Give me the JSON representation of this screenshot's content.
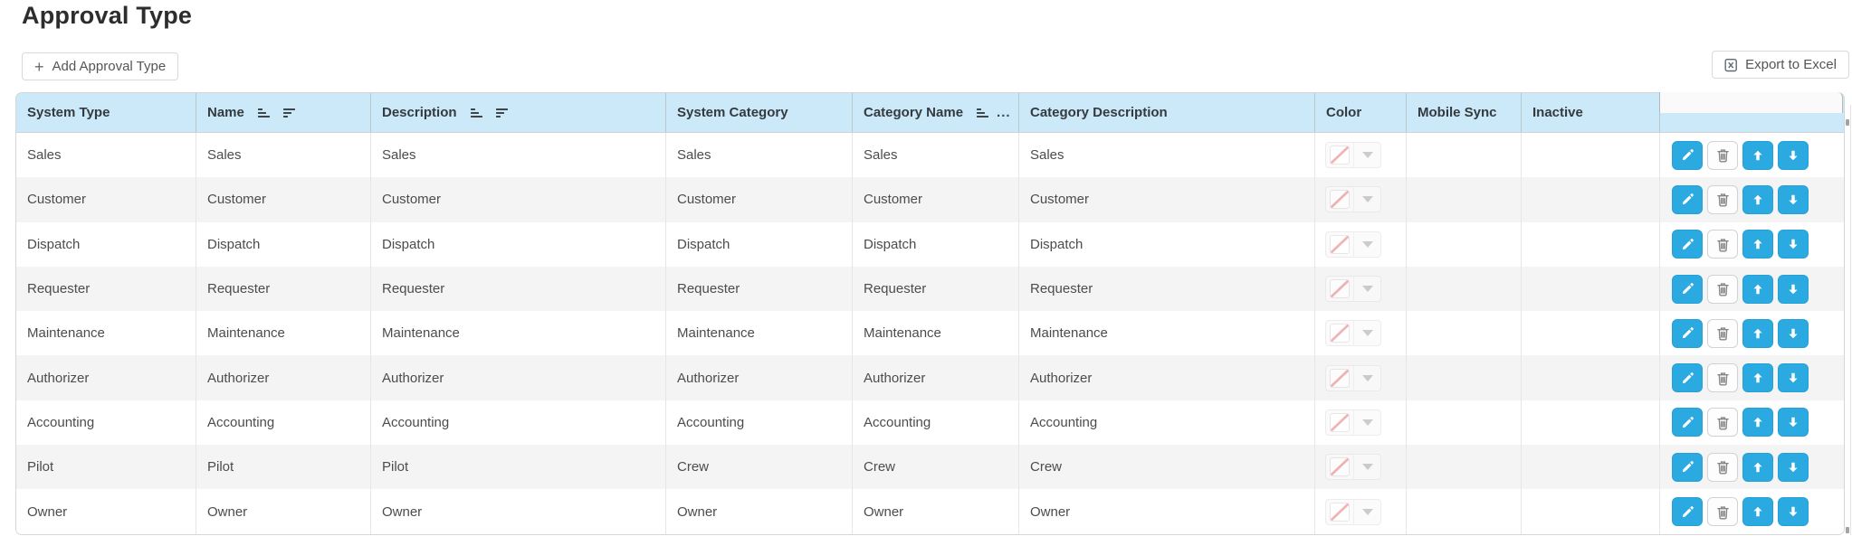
{
  "page": {
    "title": "Approval Type"
  },
  "toolbar": {
    "add_label": "Add Approval Type",
    "plus_glyph": "+",
    "export_label": "Export to Excel"
  },
  "grid": {
    "ellipsis_glyph": "...",
    "columns": [
      {
        "label": "System Type",
        "icons": []
      },
      {
        "label": "Name",
        "icons": [
          "asc",
          "desc"
        ]
      },
      {
        "label": "Description",
        "icons": [
          "asc",
          "desc"
        ]
      },
      {
        "label": "System Category",
        "icons": []
      },
      {
        "label": "Category Name",
        "icons": [
          "asc",
          "ellipsis"
        ]
      },
      {
        "label": "Category Description",
        "icons": []
      },
      {
        "label": "Color",
        "icons": []
      },
      {
        "label": "Mobile Sync",
        "icons": []
      },
      {
        "label": "Inactive",
        "icons": []
      },
      {
        "label": "",
        "icons": []
      }
    ],
    "rows": [
      {
        "system_type": "Sales",
        "name": "Sales",
        "description": "Sales",
        "system_category": "Sales",
        "category_name": "Sales",
        "category_description": "Sales",
        "color": "none",
        "mobile_sync": "",
        "inactive": ""
      },
      {
        "system_type": "Customer",
        "name": "Customer",
        "description": "Customer",
        "system_category": "Customer",
        "category_name": "Customer",
        "category_description": "Customer",
        "color": "none",
        "mobile_sync": "",
        "inactive": ""
      },
      {
        "system_type": "Dispatch",
        "name": "Dispatch",
        "description": "Dispatch",
        "system_category": "Dispatch",
        "category_name": "Dispatch",
        "category_description": "Dispatch",
        "color": "none",
        "mobile_sync": "",
        "inactive": ""
      },
      {
        "system_type": "Requester",
        "name": "Requester",
        "description": "Requester",
        "system_category": "Requester",
        "category_name": "Requester",
        "category_description": "Requester",
        "color": "none",
        "mobile_sync": "",
        "inactive": ""
      },
      {
        "system_type": "Maintenance",
        "name": "Maintenance",
        "description": "Maintenance",
        "system_category": "Maintenance",
        "category_name": "Maintenance",
        "category_description": "Maintenance",
        "color": "none",
        "mobile_sync": "",
        "inactive": ""
      },
      {
        "system_type": "Authorizer",
        "name": "Authorizer",
        "description": "Authorizer",
        "system_category": "Authorizer",
        "category_name": "Authorizer",
        "category_description": "Authorizer",
        "color": "none",
        "mobile_sync": "",
        "inactive": ""
      },
      {
        "system_type": "Accounting",
        "name": "Accounting",
        "description": "Accounting",
        "system_category": "Accounting",
        "category_name": "Accounting",
        "category_description": "Accounting",
        "color": "none",
        "mobile_sync": "",
        "inactive": ""
      },
      {
        "system_type": "Pilot",
        "name": "Pilot",
        "description": "Pilot",
        "system_category": "Crew",
        "category_name": "Crew",
        "category_description": "Crew",
        "color": "none",
        "mobile_sync": "",
        "inactive": ""
      },
      {
        "system_type": "Owner",
        "name": "Owner",
        "description": "Owner",
        "system_category": "Owner",
        "category_name": "Owner",
        "category_description": "Owner",
        "color": "none",
        "mobile_sync": "",
        "inactive": ""
      }
    ],
    "row_actions": [
      "edit",
      "delete",
      "move-up",
      "move-down"
    ]
  },
  "colors": {
    "header_bg": "#cbe9f9",
    "primary_button": "#2ba9e1",
    "row_stripe": "#f4f4f4",
    "no_color_slash": "#eb9c9c",
    "header_text": "#353a3e",
    "cell_text": "#4c4c4c"
  }
}
